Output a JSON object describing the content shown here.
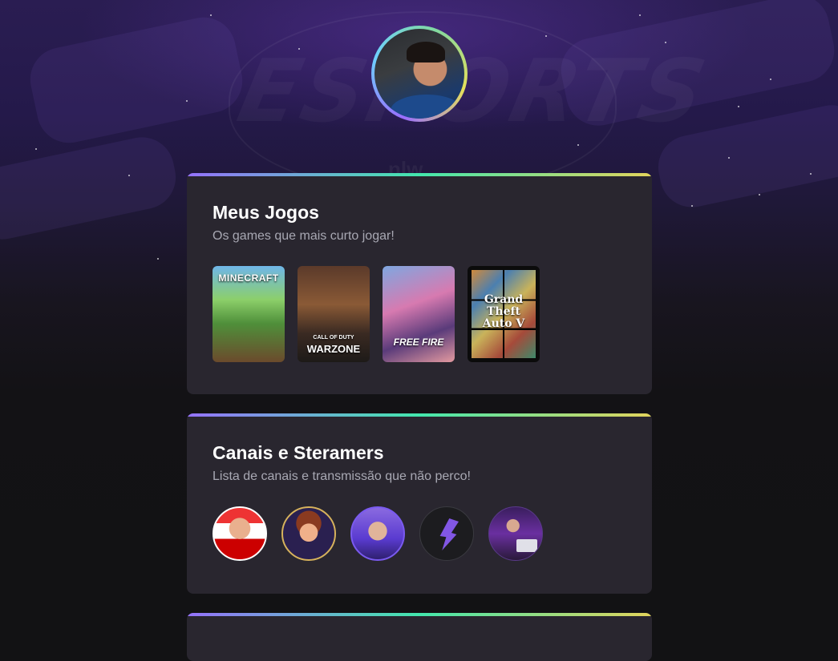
{
  "background": {
    "watermark_text": "ESPORTS",
    "brand_text": "nlw"
  },
  "profile": {
    "avatar_icon": "profile-photo"
  },
  "cards": {
    "games": {
      "title": "Meus Jogos",
      "subtitle": "Os games que mais curto jogar!",
      "items": [
        {
          "name": "MINECRAFT"
        },
        {
          "name": "WARZONE",
          "pre": "CALL OF DUTY"
        },
        {
          "name": "FREE FIRE"
        },
        {
          "name": "Grand Theft Auto V"
        }
      ]
    },
    "streamers": {
      "title": "Canais e Steramers",
      "subtitle": "Lista de canais e transmissão que não perco!",
      "items": [
        {
          "icon": "streamer-avatar-red"
        },
        {
          "icon": "streamer-avatar-cartoon"
        },
        {
          "icon": "streamer-avatar-purple"
        },
        {
          "icon": "rocketseat-icon"
        },
        {
          "icon": "streamer-avatar-laptop"
        }
      ]
    }
  },
  "colors": {
    "card_bg": "#29262f",
    "gradient_start": "#9572fc",
    "gradient_mid": "#43e7ad",
    "gradient_end": "#e2d45c",
    "subtitle": "#a8a8b3"
  }
}
